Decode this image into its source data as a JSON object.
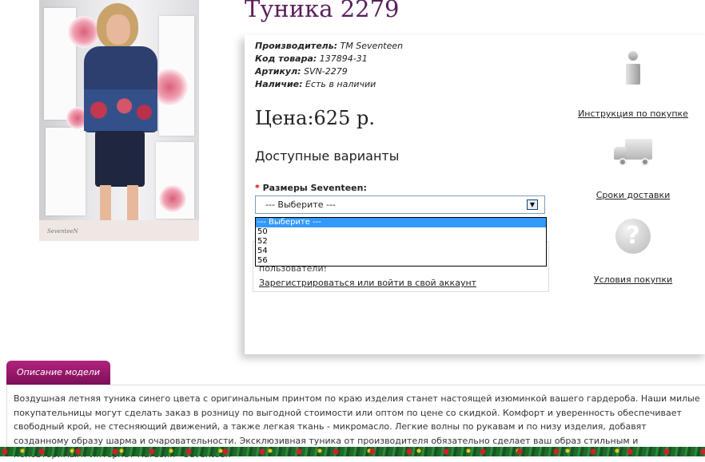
{
  "product": {
    "title": "Туника 2279",
    "photo_signature": "SeventeeN"
  },
  "meta": {
    "manufacturer_label": "Производитель:",
    "manufacturer_value": "TM Seventeen",
    "code_label": "Код товара:",
    "code_value": "137894-31",
    "sku_label": "Артикул:",
    "sku_value": "SVN-2279",
    "stock_label": "Наличие:",
    "stock_value": "Есть в наличии"
  },
  "price": "Цена:625 р.",
  "variants": {
    "title": "Доступные варианты",
    "required_mark": "*",
    "size_label": "Размеры Seventeen:",
    "selected": "--- Выберите ---",
    "options": [
      "--- Выберите ---",
      "50",
      "52",
      "54",
      "56"
    ]
  },
  "login": {
    "hint": "пользователи!",
    "link": "Зарегистрироваться или войти в свой аккаунт"
  },
  "side": {
    "instruction": "Инструкция по покупке",
    "delivery": "Сроки доставки",
    "conditions": "Условия покупки",
    "question_glyph": "?"
  },
  "description": {
    "tab_label": "Описание модели",
    "text": "Воздушная летняя туника синего цвета с оригинальным принтом по краю изделия станет настоящей изюминкой вашего гардероба. Наши милые покупательницы могут сделать заказ в розницу по выгодной стоимости или оптом по цене со скидкой. Комфорт и уверенность обеспечивает свободный крой, не стесняющий движений, а также легкая ткань - микромасло. Легкие волны по рукавам и по низу изделия, добавят созданному образу шарма и очаровательности. Эксклюзивная туника от производителя обязательно сделает ваш образ стильным и неповторимым! Интернет-магазин «Seventeen»"
  },
  "colors": {
    "title": "#5a1f5a",
    "tab": "#9a1a6e",
    "dropdown_highlight": "#3399ff"
  }
}
